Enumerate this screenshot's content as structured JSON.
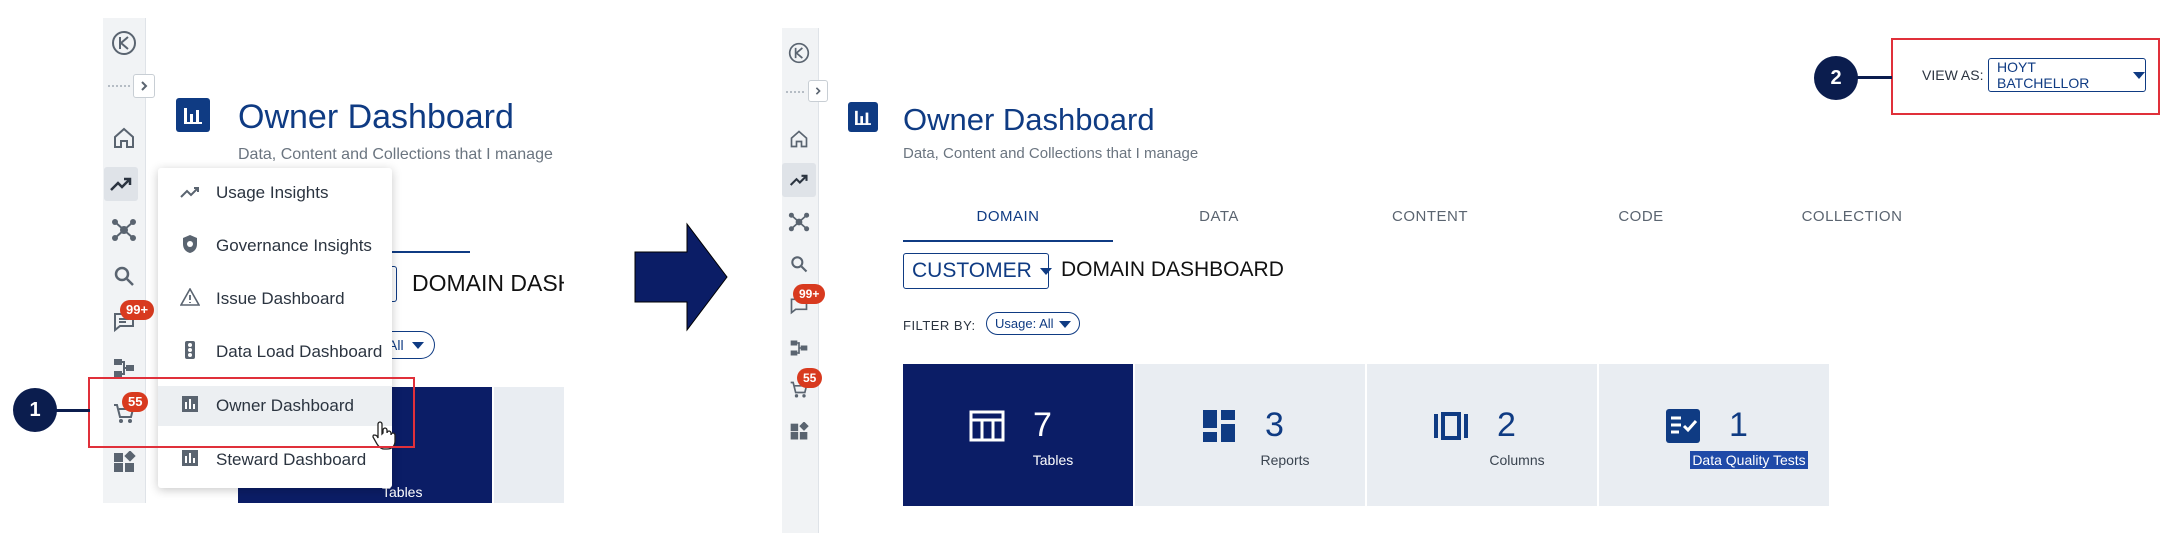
{
  "left_panel": {
    "title": "Owner Dashboard",
    "subtitle": "Data, Content and Collections that I manage",
    "cart_badge": "55",
    "messages_badge": "99+",
    "partial_domain_label": "DOMAIN DASH",
    "partial_filter_value": "All",
    "partial_card_label": "Tables",
    "menu": {
      "items": [
        {
          "label": "Usage Insights",
          "icon": "trend-icon"
        },
        {
          "label": "Governance Insights",
          "icon": "shield-icon"
        },
        {
          "label": "Issue Dashboard",
          "icon": "warning-icon"
        },
        {
          "label": "Data Load Dashboard",
          "icon": "traffic-light-icon"
        },
        {
          "label": "Owner Dashboard",
          "icon": "bar-chart-icon"
        },
        {
          "label": "Steward Dashboard",
          "icon": "bar-chart-icon"
        }
      ]
    }
  },
  "callouts": {
    "step1": "1",
    "step2": "2"
  },
  "right_panel": {
    "view_as_label": "VIEW AS:",
    "view_as_value": "HOYT BATCHELLOR",
    "title": "Owner Dashboard",
    "subtitle": "Data, Content and Collections that I manage",
    "tabs": [
      "DOMAIN",
      "DATA",
      "CONTENT",
      "CODE",
      "COLLECTION"
    ],
    "active_tab": "DOMAIN",
    "domain_select": "CUSTOMER",
    "domain_dashboard_label": "DOMAIN DASHBOARD",
    "filter_label": "FILTER BY:",
    "filter_value": "Usage: All",
    "messages_badge": "99+",
    "cart_badge": "55",
    "cards": [
      {
        "value": "7",
        "label": "Tables",
        "icon": "table-icon"
      },
      {
        "value": "3",
        "label": "Reports",
        "icon": "dashboard-icon"
      },
      {
        "value": "2",
        "label": "Columns",
        "icon": "columns-icon"
      },
      {
        "value": "1",
        "label": "Data Quality Tests",
        "icon": "checklist-icon"
      }
    ]
  },
  "colors": {
    "brand": "#0f3b83",
    "selected_card": "#0b1d66",
    "highlight_red": "#e0303a",
    "badge": "#d83a1f"
  }
}
